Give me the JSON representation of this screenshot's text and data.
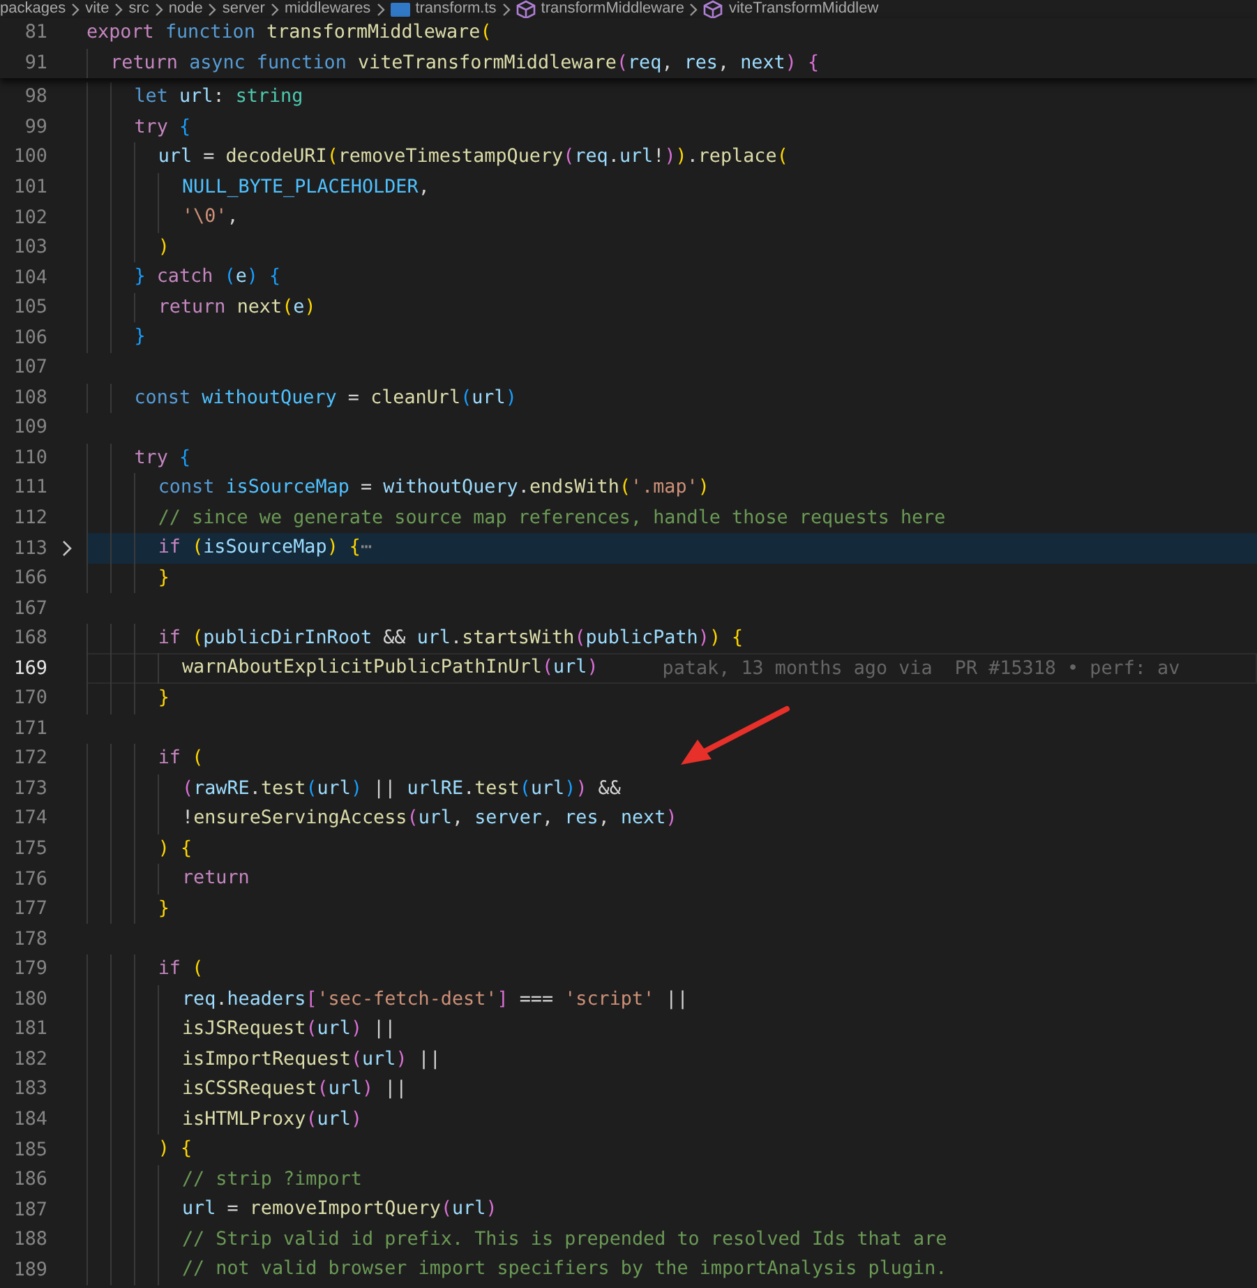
{
  "breadcrumbs": [
    {
      "kind": "folder",
      "label": "packages"
    },
    {
      "kind": "folder",
      "label": "vite"
    },
    {
      "kind": "folder",
      "label": "src"
    },
    {
      "kind": "folder",
      "label": "node"
    },
    {
      "kind": "folder",
      "label": "server"
    },
    {
      "kind": "folder",
      "label": "middlewares"
    },
    {
      "kind": "file",
      "label": "transform.ts"
    },
    {
      "kind": "symbol",
      "label": "transformMiddleware"
    },
    {
      "kind": "symbol",
      "label": "viteTransformMiddlew"
    }
  ],
  "sticky_lines": [
    {
      "number": "81",
      "tokens": [
        {
          "kind": "kw",
          "text": "export "
        },
        {
          "kind": "st",
          "text": "function "
        },
        {
          "kind": "f",
          "text": "transformMiddleware"
        },
        {
          "kind": "b1",
          "text": "("
        }
      ]
    },
    {
      "number": "91",
      "tokens": [
        {
          "kind": "kw",
          "text": "  return "
        },
        {
          "kind": "st",
          "text": "async function "
        },
        {
          "kind": "f",
          "text": "viteTransformMiddleware"
        },
        {
          "kind": "b2",
          "text": "("
        },
        {
          "kind": "v",
          "text": "req"
        },
        {
          "kind": "p",
          "text": ", "
        },
        {
          "kind": "v",
          "text": "res"
        },
        {
          "kind": "p",
          "text": ", "
        },
        {
          "kind": "v",
          "text": "next"
        },
        {
          "kind": "b2",
          "text": ") {"
        }
      ]
    }
  ],
  "lines": [
    {
      "number": "98",
      "tokens": [
        {
          "kind": "st",
          "text": "    let "
        },
        {
          "kind": "v",
          "text": "url"
        },
        {
          "kind": "p",
          "text": ": "
        },
        {
          "kind": "ty",
          "text": "string"
        }
      ]
    },
    {
      "number": "99",
      "tokens": [
        {
          "kind": "kw",
          "text": "    try "
        },
        {
          "kind": "b3",
          "text": "{"
        }
      ]
    },
    {
      "number": "100",
      "tokens": [
        {
          "kind": "v",
          "text": "      url"
        },
        {
          "kind": "p",
          "text": " = "
        },
        {
          "kind": "f",
          "text": "decodeURI"
        },
        {
          "kind": "b1",
          "text": "("
        },
        {
          "kind": "f",
          "text": "removeTimestampQuery"
        },
        {
          "kind": "b2",
          "text": "("
        },
        {
          "kind": "v",
          "text": "req"
        },
        {
          "kind": "p",
          "text": "."
        },
        {
          "kind": "v",
          "text": "url"
        },
        {
          "kind": "p",
          "text": "!"
        },
        {
          "kind": "b2",
          "text": ")"
        },
        {
          "kind": "b1",
          "text": ")"
        },
        {
          "kind": "p",
          "text": "."
        },
        {
          "kind": "f",
          "text": "replace"
        },
        {
          "kind": "b1",
          "text": "("
        }
      ]
    },
    {
      "number": "101",
      "tokens": [
        {
          "kind": "c",
          "text": "        NULL_BYTE_PLACEHOLDER"
        },
        {
          "kind": "p",
          "text": ","
        }
      ]
    },
    {
      "number": "102",
      "tokens": [
        {
          "kind": "s",
          "text": "        '\\0'"
        },
        {
          "kind": "p",
          "text": ","
        }
      ]
    },
    {
      "number": "103",
      "tokens": [
        {
          "kind": "b1",
          "text": "      )"
        }
      ]
    },
    {
      "number": "104",
      "tokens": [
        {
          "kind": "b3",
          "text": "    } "
        },
        {
          "kind": "kw",
          "text": "catch "
        },
        {
          "kind": "b3",
          "text": "("
        },
        {
          "kind": "v",
          "text": "e"
        },
        {
          "kind": "b3",
          "text": ") {"
        }
      ]
    },
    {
      "number": "105",
      "tokens": [
        {
          "kind": "kw",
          "text": "      return "
        },
        {
          "kind": "f",
          "text": "next"
        },
        {
          "kind": "b1",
          "text": "("
        },
        {
          "kind": "v",
          "text": "e"
        },
        {
          "kind": "b1",
          "text": ")"
        }
      ]
    },
    {
      "number": "106",
      "tokens": [
        {
          "kind": "b3",
          "text": "    }"
        }
      ]
    },
    {
      "number": "107"
    },
    {
      "number": "108",
      "tokens": [
        {
          "kind": "st",
          "text": "    const "
        },
        {
          "kind": "c",
          "text": "withoutQuery"
        },
        {
          "kind": "p",
          "text": " = "
        },
        {
          "kind": "f",
          "text": "cleanUrl"
        },
        {
          "kind": "b3",
          "text": "("
        },
        {
          "kind": "v",
          "text": "url"
        },
        {
          "kind": "b3",
          "text": ")"
        }
      ]
    },
    {
      "number": "109"
    },
    {
      "number": "110",
      "tokens": [
        {
          "kind": "kw",
          "text": "    try "
        },
        {
          "kind": "b3",
          "text": "{"
        }
      ]
    },
    {
      "number": "111",
      "tokens": [
        {
          "kind": "st",
          "text": "      const "
        },
        {
          "kind": "c",
          "text": "isSourceMap"
        },
        {
          "kind": "p",
          "text": " = "
        },
        {
          "kind": "v",
          "text": "withoutQuery"
        },
        {
          "kind": "p",
          "text": "."
        },
        {
          "kind": "f",
          "text": "endsWith"
        },
        {
          "kind": "b1",
          "text": "("
        },
        {
          "kind": "s",
          "text": "'.map'"
        },
        {
          "kind": "b1",
          "text": ")"
        }
      ]
    },
    {
      "number": "112",
      "tokens": [
        {
          "kind": "cm",
          "text": "      // since we generate source map references, handle those requests here"
        }
      ]
    },
    {
      "number": "113",
      "folded": true,
      "selected": true,
      "tokens": [
        {
          "kind": "kw",
          "text": "      if "
        },
        {
          "kind": "b1",
          "text": "("
        },
        {
          "kind": "v",
          "text": "isSourceMap"
        },
        {
          "kind": "b1",
          "text": ") {"
        },
        {
          "kind": "fold",
          "text": "⋯"
        }
      ]
    },
    {
      "number": "166",
      "tokens": [
        {
          "kind": "b1",
          "text": "      }"
        }
      ]
    },
    {
      "number": "167"
    },
    {
      "number": "168",
      "tokens": [
        {
          "kind": "kw",
          "text": "      if "
        },
        {
          "kind": "b1",
          "text": "("
        },
        {
          "kind": "v",
          "text": "publicDirInRoot"
        },
        {
          "kind": "p",
          "text": " && "
        },
        {
          "kind": "v",
          "text": "url"
        },
        {
          "kind": "p",
          "text": "."
        },
        {
          "kind": "f",
          "text": "startsWith"
        },
        {
          "kind": "b2",
          "text": "("
        },
        {
          "kind": "v",
          "text": "publicPath"
        },
        {
          "kind": "b2",
          "text": ")"
        },
        {
          "kind": "b1",
          "text": ") {"
        }
      ]
    },
    {
      "number": "169",
      "current": true,
      "blame": "patak, 13 months ago via  PR #15318 • perf: av",
      "tokens": [
        {
          "kind": "f",
          "text": "        warnAboutExplicitPublicPathInUrl"
        },
        {
          "kind": "b2",
          "text": "("
        },
        {
          "kind": "v",
          "text": "url"
        },
        {
          "kind": "b2",
          "text": ")"
        }
      ]
    },
    {
      "number": "170",
      "tokens": [
        {
          "kind": "b1",
          "text": "      }"
        }
      ]
    },
    {
      "number": "171"
    },
    {
      "number": "172",
      "tokens": [
        {
          "kind": "kw",
          "text": "      if "
        },
        {
          "kind": "b1",
          "text": "("
        }
      ]
    },
    {
      "number": "173",
      "tokens": [
        {
          "kind": "b2",
          "text": "        ("
        },
        {
          "kind": "v",
          "text": "rawRE"
        },
        {
          "kind": "p",
          "text": "."
        },
        {
          "kind": "f",
          "text": "test"
        },
        {
          "kind": "b3",
          "text": "("
        },
        {
          "kind": "v",
          "text": "url"
        },
        {
          "kind": "b3",
          "text": ")"
        },
        {
          "kind": "p",
          "text": " || "
        },
        {
          "kind": "v",
          "text": "urlRE"
        },
        {
          "kind": "p",
          "text": "."
        },
        {
          "kind": "f",
          "text": "test"
        },
        {
          "kind": "b3",
          "text": "("
        },
        {
          "kind": "v",
          "text": "url"
        },
        {
          "kind": "b3",
          "text": ")"
        },
        {
          "kind": "b2",
          "text": ")"
        },
        {
          "kind": "p",
          "text": " &&"
        }
      ]
    },
    {
      "number": "174",
      "tokens": [
        {
          "kind": "p",
          "text": "        !"
        },
        {
          "kind": "f",
          "text": "ensureServingAccess"
        },
        {
          "kind": "b2",
          "text": "("
        },
        {
          "kind": "v",
          "text": "url"
        },
        {
          "kind": "p",
          "text": ", "
        },
        {
          "kind": "v",
          "text": "server"
        },
        {
          "kind": "p",
          "text": ", "
        },
        {
          "kind": "v",
          "text": "res"
        },
        {
          "kind": "p",
          "text": ", "
        },
        {
          "kind": "v",
          "text": "next"
        },
        {
          "kind": "b2",
          "text": ")"
        }
      ]
    },
    {
      "number": "175",
      "tokens": [
        {
          "kind": "b1",
          "text": "      ) {"
        }
      ]
    },
    {
      "number": "176",
      "tokens": [
        {
          "kind": "kw",
          "text": "        return"
        }
      ]
    },
    {
      "number": "177",
      "tokens": [
        {
          "kind": "b1",
          "text": "      }"
        }
      ]
    },
    {
      "number": "178"
    },
    {
      "number": "179",
      "tokens": [
        {
          "kind": "kw",
          "text": "      if "
        },
        {
          "kind": "b1",
          "text": "("
        }
      ]
    },
    {
      "number": "180",
      "tokens": [
        {
          "kind": "v",
          "text": "        req"
        },
        {
          "kind": "p",
          "text": "."
        },
        {
          "kind": "v",
          "text": "headers"
        },
        {
          "kind": "b2",
          "text": "["
        },
        {
          "kind": "s",
          "text": "'sec-fetch-dest'"
        },
        {
          "kind": "b2",
          "text": "]"
        },
        {
          "kind": "p",
          "text": " === "
        },
        {
          "kind": "s",
          "text": "'script'"
        },
        {
          "kind": "p",
          "text": " ||"
        }
      ]
    },
    {
      "number": "181",
      "tokens": [
        {
          "kind": "f",
          "text": "        isJSRequest"
        },
        {
          "kind": "b2",
          "text": "("
        },
        {
          "kind": "v",
          "text": "url"
        },
        {
          "kind": "b2",
          "text": ")"
        },
        {
          "kind": "p",
          "text": " ||"
        }
      ]
    },
    {
      "number": "182",
      "tokens": [
        {
          "kind": "f",
          "text": "        isImportRequest"
        },
        {
          "kind": "b2",
          "text": "("
        },
        {
          "kind": "v",
          "text": "url"
        },
        {
          "kind": "b2",
          "text": ")"
        },
        {
          "kind": "p",
          "text": " ||"
        }
      ]
    },
    {
      "number": "183",
      "tokens": [
        {
          "kind": "f",
          "text": "        isCSSRequest"
        },
        {
          "kind": "b2",
          "text": "("
        },
        {
          "kind": "v",
          "text": "url"
        },
        {
          "kind": "b2",
          "text": ")"
        },
        {
          "kind": "p",
          "text": " ||"
        }
      ]
    },
    {
      "number": "184",
      "tokens": [
        {
          "kind": "f",
          "text": "        isHTMLProxy"
        },
        {
          "kind": "b2",
          "text": "("
        },
        {
          "kind": "v",
          "text": "url"
        },
        {
          "kind": "b2",
          "text": ")"
        }
      ]
    },
    {
      "number": "185",
      "tokens": [
        {
          "kind": "b1",
          "text": "      ) {"
        }
      ]
    },
    {
      "number": "186",
      "tokens": [
        {
          "kind": "cm",
          "text": "        // strip ?import"
        }
      ]
    },
    {
      "number": "187",
      "tokens": [
        {
          "kind": "v",
          "text": "        url"
        },
        {
          "kind": "p",
          "text": " = "
        },
        {
          "kind": "f",
          "text": "removeImportQuery"
        },
        {
          "kind": "b2",
          "text": "("
        },
        {
          "kind": "v",
          "text": "url"
        },
        {
          "kind": "b2",
          "text": ")"
        }
      ]
    },
    {
      "number": "188",
      "tokens": [
        {
          "kind": "cm",
          "text": "        // Strip valid id prefix. This is prepended to resolved Ids that are"
        }
      ]
    },
    {
      "number": "189",
      "tokens": [
        {
          "kind": "cm",
          "text": "        // not valid browser import specifiers by the importAnalysis plugin."
        }
      ]
    }
  ],
  "annotation": {
    "kind": "arrow"
  }
}
